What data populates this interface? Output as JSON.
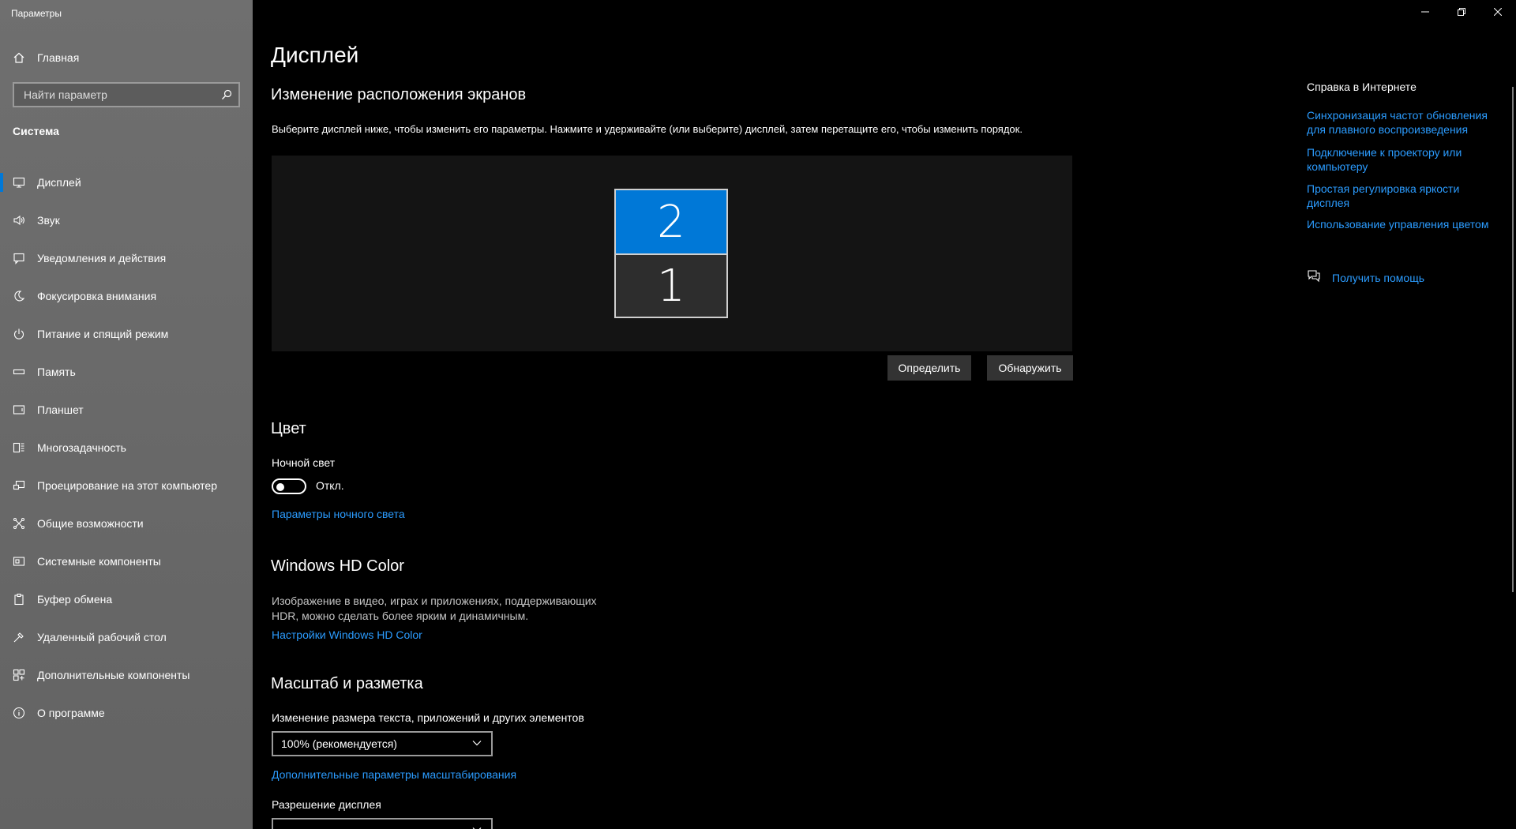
{
  "window": {
    "title": "Параметры",
    "controls": {
      "minimize": "minimize",
      "restore": "restore",
      "close": "close"
    }
  },
  "sidebar": {
    "home_label": "Главная",
    "search_placeholder": "Найти параметр",
    "section_label": "Система",
    "items": [
      {
        "label": "Дисплей",
        "icon": "monitor-icon",
        "active": true
      },
      {
        "label": "Звук",
        "icon": "speaker-icon"
      },
      {
        "label": "Уведомления и действия",
        "icon": "notification-icon"
      },
      {
        "label": "Фокусировка внимания",
        "icon": "moon-icon"
      },
      {
        "label": "Питание и спящий режим",
        "icon": "power-icon"
      },
      {
        "label": "Память",
        "icon": "storage-icon"
      },
      {
        "label": "Планшет",
        "icon": "tablet-icon"
      },
      {
        "label": "Многозадачность",
        "icon": "multitasking-icon"
      },
      {
        "label": "Проецирование на этот компьютер",
        "icon": "projecting-icon"
      },
      {
        "label": "Общие возможности",
        "icon": "shared-experiences-icon"
      },
      {
        "label": "Системные компоненты",
        "icon": "system-components-icon"
      },
      {
        "label": "Буфер обмена",
        "icon": "clipboard-icon"
      },
      {
        "label": "Удаленный рабочий стол",
        "icon": "remote-desktop-icon"
      },
      {
        "label": "Дополнительные компоненты",
        "icon": "optional-features-icon"
      },
      {
        "label": "О программе",
        "icon": "info-icon"
      }
    ]
  },
  "main": {
    "title": "Дисплей",
    "arrange": {
      "heading": "Изменение расположения экранов",
      "description": "Выберите дисплей ниже, чтобы изменить его параметры. Нажмите и удерживайте (или выберите) дисплей, затем перетащите его, чтобы изменить порядок.",
      "monitor_top": "2",
      "monitor_bottom": "1",
      "identify_button": "Определить",
      "detect_button": "Обнаружить"
    },
    "color": {
      "heading": "Цвет",
      "night_light_label": "Ночной свет",
      "night_light_state": "Откл.",
      "night_light_on": false,
      "night_light_settings_link": "Параметры ночного света"
    },
    "hdr": {
      "heading": "Windows HD Color",
      "description_line1": "Изображение в видео, играх и приложениях, поддерживающих",
      "description_line2": "HDR, можно сделать более ярким и динамичным.",
      "settings_link": "Настройки Windows HD Color"
    },
    "scale": {
      "heading": "Масштаб и разметка",
      "size_label": "Изменение размера текста, приложений и других элементов",
      "size_value": "100% (рекомендуется)",
      "advanced_link": "Дополнительные параметры масштабирования",
      "resolution_label": "Разрешение дисплея"
    }
  },
  "right_pane": {
    "heading": "Справка в Интернете",
    "links": [
      {
        "line1": "Синхронизация частот обновления",
        "line2": "для плавного воспроизведения"
      },
      {
        "line1": "Подключение к проектору или",
        "line2": "компьютеру"
      },
      {
        "line1": "Простая регулировка яркости",
        "line2": "дисплея"
      },
      {
        "line1": "Использование управления цветом",
        "line2": ""
      }
    ],
    "help_link": "Получить помощь"
  },
  "colors": {
    "accent": "#0078d7",
    "link": "#2b9cff",
    "sidebar_bg": "#6b6b6b",
    "content_bg": "#000000"
  }
}
